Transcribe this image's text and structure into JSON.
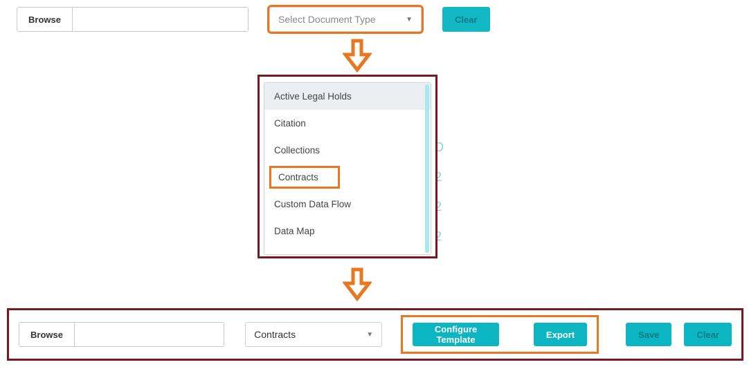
{
  "step1": {
    "browse_label": "Browse",
    "dropdown_placeholder": "Select Document Type",
    "clear_label": "Clear"
  },
  "dropdown": {
    "options": {
      "0": "Active Legal Holds",
      "1": "Citation",
      "2": "Collections",
      "3": "Contracts",
      "4": "Custom Data Flow",
      "5": "Data Map"
    }
  },
  "step3": {
    "browse_label": "Browse",
    "selected_value": "Contracts",
    "configure_label": "Configure Template",
    "export_label": "Export",
    "save_label": "Save",
    "clear_label": "Clear"
  },
  "bg_digits": {
    "d0": "D",
    "d1": "2",
    "d2": "2",
    "d3": "2"
  }
}
